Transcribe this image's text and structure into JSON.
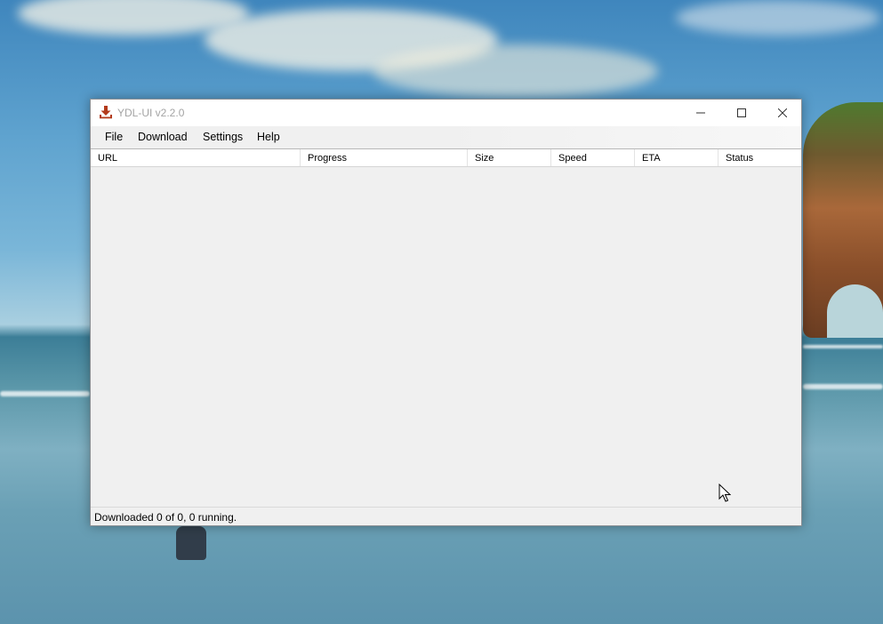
{
  "window": {
    "title": "YDL-UI v2.2.0",
    "icon": "download-icon",
    "accent": "#b33a1b",
    "controls": [
      "minimize-icon",
      "maximize-icon",
      "close-icon"
    ]
  },
  "menu": {
    "items": [
      {
        "label": "File"
      },
      {
        "label": "Download"
      },
      {
        "label": "Settings"
      },
      {
        "label": "Help"
      }
    ]
  },
  "table": {
    "columns": [
      "URL",
      "Progress",
      "Size",
      "Speed",
      "ETA",
      "Status"
    ],
    "rows": []
  },
  "status": {
    "text": "Downloaded 0 of 0, 0 running."
  }
}
